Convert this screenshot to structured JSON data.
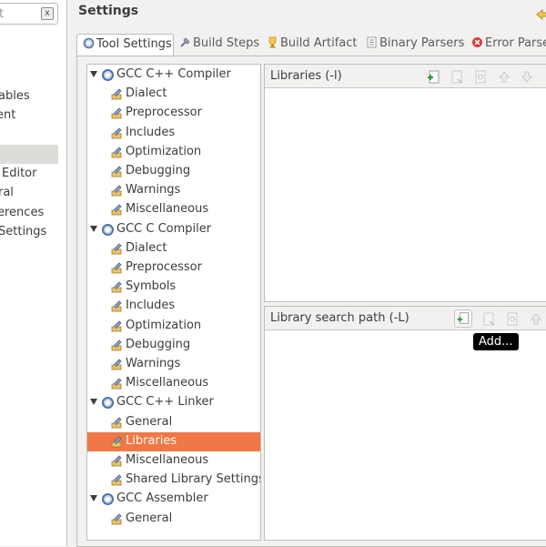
{
  "left_panel": {
    "filter_placeholder": "t",
    "clear_label": "x",
    "items": [
      "ables",
      "ent",
      "Editor",
      "ral",
      "erences",
      "Settings"
    ]
  },
  "header": {
    "title": "Settings"
  },
  "tabs": [
    {
      "label": "Tool Settings",
      "icon": "tool-settings-icon"
    },
    {
      "label": "Build Steps",
      "icon": "build-steps-icon"
    },
    {
      "label": "Build Artifact",
      "icon": "build-artifact-icon"
    },
    {
      "label": "Binary Parsers",
      "icon": "binary-parsers-icon"
    },
    {
      "label": "Error Parsers",
      "icon": "error-parsers-icon"
    }
  ],
  "tree": [
    {
      "label": "GCC C++ Compiler",
      "kind": "tool"
    },
    {
      "label": "Dialect",
      "kind": "option"
    },
    {
      "label": "Preprocessor",
      "kind": "option"
    },
    {
      "label": "Includes",
      "kind": "option"
    },
    {
      "label": "Optimization",
      "kind": "option"
    },
    {
      "label": "Debugging",
      "kind": "option"
    },
    {
      "label": "Warnings",
      "kind": "option"
    },
    {
      "label": "Miscellaneous",
      "kind": "option"
    },
    {
      "label": "GCC C Compiler",
      "kind": "tool"
    },
    {
      "label": "Dialect",
      "kind": "option"
    },
    {
      "label": "Preprocessor",
      "kind": "option"
    },
    {
      "label": "Symbols",
      "kind": "option"
    },
    {
      "label": "Includes",
      "kind": "option"
    },
    {
      "label": "Optimization",
      "kind": "option"
    },
    {
      "label": "Debugging",
      "kind": "option"
    },
    {
      "label": "Warnings",
      "kind": "option"
    },
    {
      "label": "Miscellaneous",
      "kind": "option"
    },
    {
      "label": "GCC C++ Linker",
      "kind": "tool"
    },
    {
      "label": "General",
      "kind": "option"
    },
    {
      "label": "Libraries",
      "kind": "option",
      "selected": true
    },
    {
      "label": "Miscellaneous",
      "kind": "option"
    },
    {
      "label": "Shared Library Settings",
      "kind": "option"
    },
    {
      "label": "GCC Assembler",
      "kind": "tool"
    },
    {
      "label": "General",
      "kind": "option"
    }
  ],
  "libraries_panel": {
    "title": "Libraries (-l)",
    "buttons": [
      "add",
      "delete",
      "edit",
      "move-up",
      "move-down"
    ]
  },
  "search_path_panel": {
    "title": "Library search path (-L)",
    "buttons": [
      "add",
      "delete",
      "edit",
      "move-up"
    ]
  },
  "tooltip": {
    "text": "Add..."
  },
  "colors": {
    "selection": "#f07746",
    "background": "#f2f1f0",
    "error_red": "#d93b3b",
    "gear_blue": "#4f74a8"
  }
}
